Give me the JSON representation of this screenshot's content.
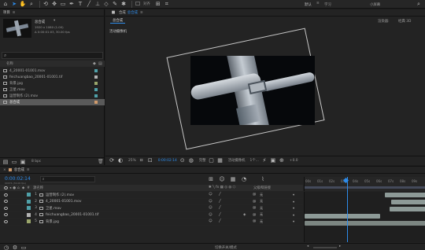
{
  "toolbar": {
    "menu": {
      "default": "默认",
      "learn": "学习",
      "small_screen": "小屏幕"
    },
    "align_label": "对齐",
    "search_label": "搜索帮助"
  },
  "project": {
    "tab_label": "项目",
    "comp_name": "总合成",
    "comp_info_1": "1920 x 1080 (1.00)",
    "comp_info_2": "Δ 0:00:01:03, 30.00 fps",
    "search_placeholder": "",
    "col_name": "名称",
    "items": [
      {
        "name": "4_20001-01001.mov",
        "color": "#4fa0a8"
      },
      {
        "name": "feichuangbao_20001-01001.tif",
        "color": "#b3b3b3"
      },
      {
        "name": "背景.jpg",
        "color": "#9aa66b"
      },
      {
        "name": "卫星.mov",
        "color": "#4fa0a8"
      },
      {
        "name": "运营制作 (2).mov",
        "color": "#4fa0a8"
      },
      {
        "name": "总合成",
        "color": "#cf9a6b"
      }
    ],
    "bpc_label": "8 bpc"
  },
  "viewer": {
    "tab_prefix": "合成",
    "tab_name": "总合成",
    "subtab": "总合成",
    "renderer_label": "渲染器:",
    "renderer_value": "经典 3D",
    "camera_label": "活动摄像机",
    "zoom": "25%",
    "timecode": "0:00:02:14",
    "quality": "完整",
    "camera_select": "活动摄像机",
    "view_count": "1个...",
    "offset": "+0.0"
  },
  "timeline": {
    "tab_label": "总合成",
    "timecode": "0:00:02:14",
    "frames": "00074 (30.00 fps)",
    "col_source": "源名称",
    "col_parent": "父级和链接",
    "layers": [
      {
        "index": "1",
        "name": "运营制作 (2).mov",
        "color": "#4fa0a8",
        "parent": "无"
      },
      {
        "index": "2",
        "name": "4_20001-01001.mov",
        "color": "#4fa0a8",
        "parent": "无"
      },
      {
        "index": "3",
        "name": "卫星.mov",
        "color": "#4fa0a8",
        "parent": "无"
      },
      {
        "index": "4",
        "name": "feichuangbao_20001-01001.tif",
        "color": "#b3b3b3",
        "parent": "无"
      },
      {
        "index": "5",
        "name": "背景.jpg",
        "color": "#9aa66b",
        "parent": "无"
      }
    ],
    "ruler": [
      "00s",
      "01s",
      "02s",
      "03s",
      "04s",
      "05s",
      "06s",
      "07s",
      "08s",
      "09s",
      "10s"
    ],
    "footer_label": "切换开关/模式",
    "colors": {
      "accent": "#2d8ceb",
      "bar": "#8d9a97",
      "selected_row": "#5a5a5a"
    }
  }
}
